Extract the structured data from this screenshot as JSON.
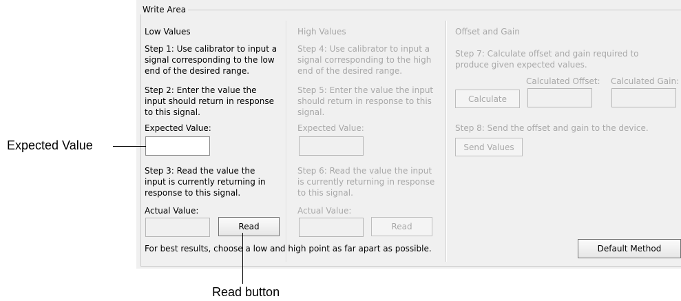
{
  "write_area": {
    "title": "Write Area",
    "low": {
      "heading": "Low Values",
      "step1": [
        "Step 1: Use calibrator to input a",
        "signal corresponding to the low",
        "end of the desired range."
      ],
      "step2": [
        "Step 2: Enter the value the",
        "input should return in response",
        "to this signal."
      ],
      "expected_label": "Expected Value:",
      "expected_value": "",
      "step3": [
        "Step 3: Read the value the",
        "input is currently returning in",
        "response to this signal."
      ],
      "actual_label": "Actual Value:",
      "actual_value": "",
      "read_button": "Read"
    },
    "high": {
      "heading": "High Values",
      "step4": [
        "Step 4: Use calibrator to input a",
        "signal corresponding to the high",
        "end of the desired range."
      ],
      "step5": [
        "Step 5: Enter the value the input",
        "should return in response to this",
        "signal."
      ],
      "expected_label": "Expected Value:",
      "expected_value": "",
      "step6": [
        "Step 6: Read the value the input",
        "is currently returning in response",
        "to this signal."
      ],
      "actual_label": "Actual Value:",
      "actual_value": "",
      "read_button": "Read"
    },
    "offset_gain": {
      "heading": "Offset and Gain",
      "step7": [
        "Step 7: Calculate offset and gain required  to",
        "produce given expected values."
      ],
      "calculate_button": "Calculate",
      "calc_offset_label": "Calculated Offset:",
      "calc_gain_label": "Calculated Gain:",
      "calc_offset_value": "",
      "calc_gain_value": "",
      "step8": "Step 8: Send the offset and gain to the device.",
      "send_button": "Send Values"
    },
    "footer_note": "For best results, choose a low and high point as far apart as possible.",
    "default_method_button": "Default Method"
  },
  "callouts": {
    "expected_value": "Expected Value",
    "read_button": "Read button"
  }
}
